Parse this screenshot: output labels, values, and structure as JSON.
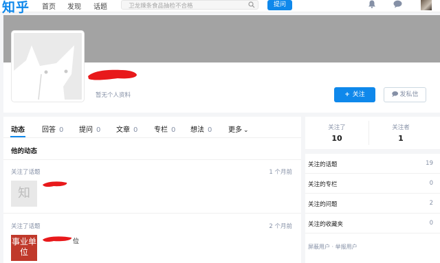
{
  "header": {
    "logo": "知乎",
    "nav": [
      "首页",
      "发现",
      "话题"
    ],
    "search_placeholder": "卫龙辣条食品抽检不合格",
    "ask_label": "提问"
  },
  "profile": {
    "no_profile_text": "暂无个人资料",
    "follow_label": "关注",
    "message_label": "发私信"
  },
  "tabs": [
    {
      "label": "动态",
      "count": ""
    },
    {
      "label": "回答",
      "count": "0"
    },
    {
      "label": "提问",
      "count": "0"
    },
    {
      "label": "文章",
      "count": "0"
    },
    {
      "label": "专栏",
      "count": "0"
    },
    {
      "label": "想法",
      "count": "0"
    },
    {
      "label": "更多",
      "count": ""
    }
  ],
  "feed": {
    "title": "他的动态",
    "items": [
      {
        "action": "关注了话题",
        "time": "1 个月前",
        "thumb": "知",
        "topic": ""
      },
      {
        "action": "关注了话题",
        "time": "2 个月前",
        "thumb": "事业单位",
        "topic": "位"
      }
    ]
  },
  "stats": {
    "following_label": "关注了",
    "following_value": "10",
    "followers_label": "关注者",
    "followers_value": "1"
  },
  "sidebar": {
    "rows": [
      {
        "label": "关注的话题",
        "value": "19"
      },
      {
        "label": "关注的专栏",
        "value": "0"
      },
      {
        "label": "关注的问题",
        "value": "2"
      },
      {
        "label": "关注的收藏夹",
        "value": "0"
      }
    ],
    "footer": "屏蔽用户 · 举报用户"
  },
  "colors": {
    "accent": "#0f88eb",
    "cover": "#a3a3a3",
    "redaction": "#e8191b"
  }
}
